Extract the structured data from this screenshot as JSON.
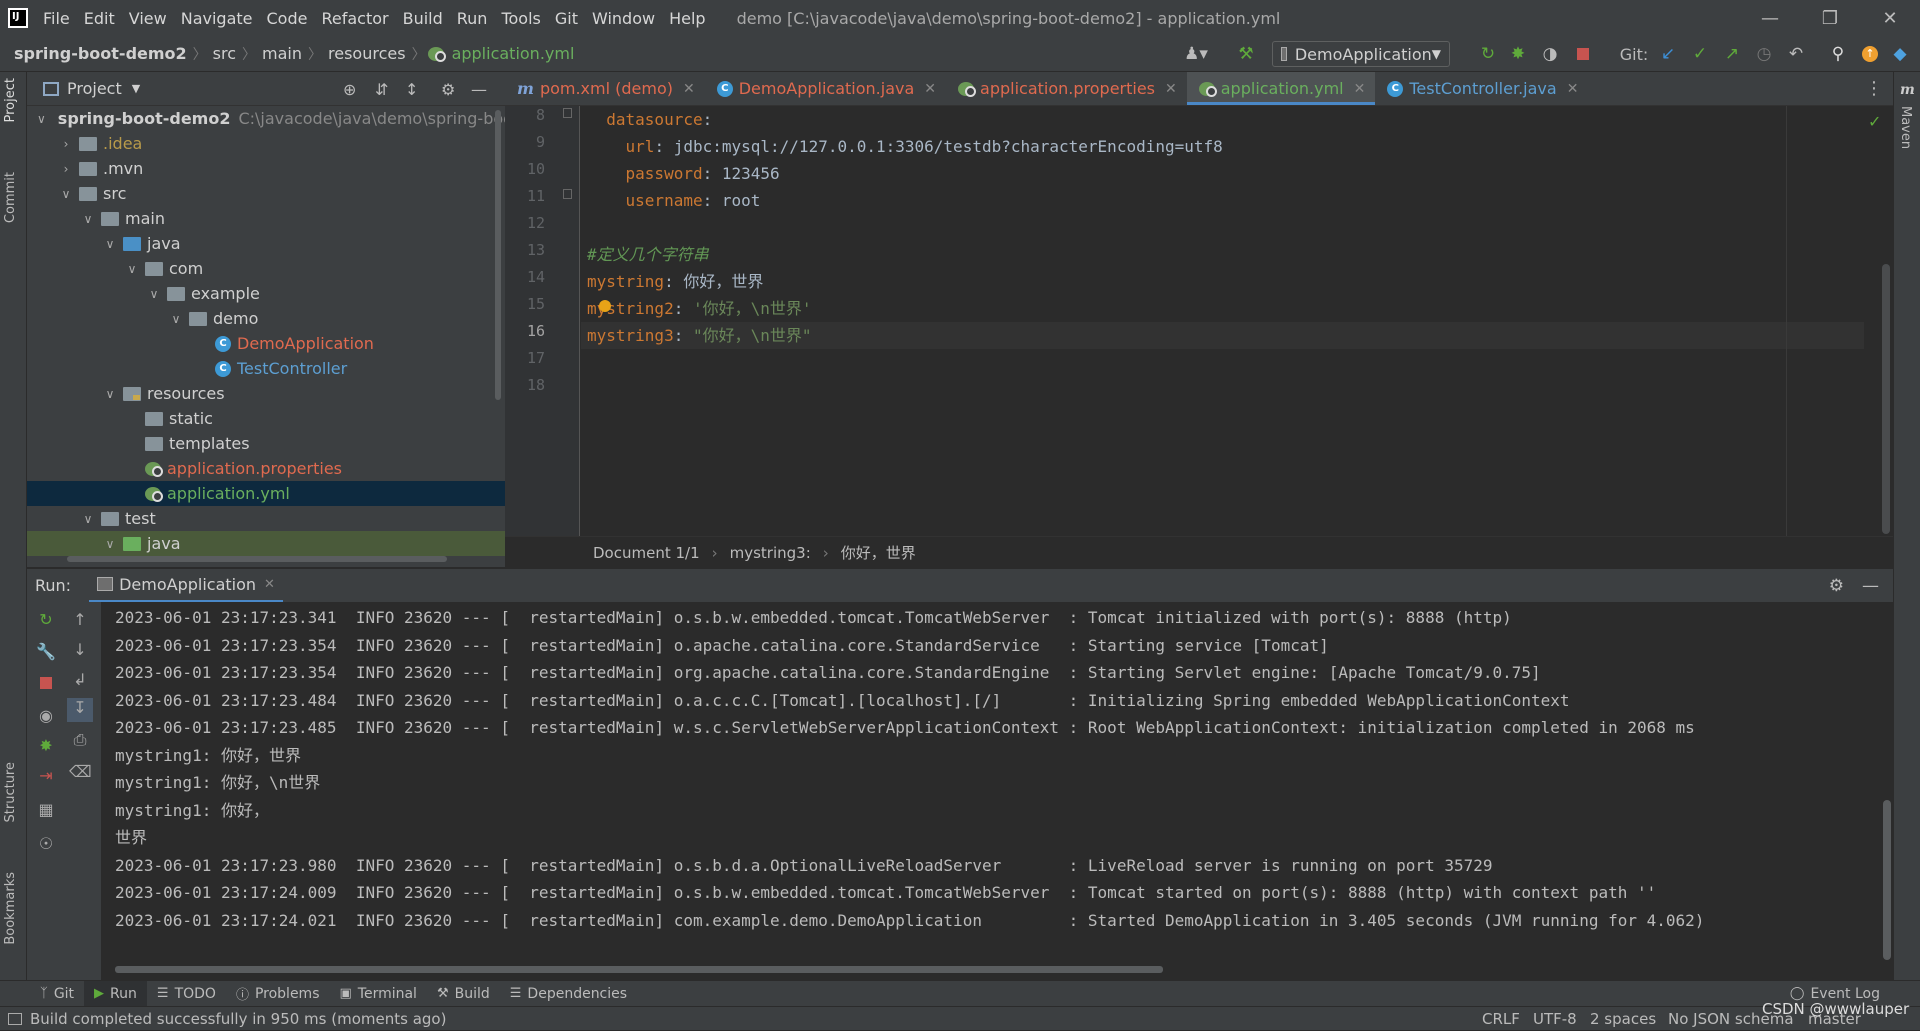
{
  "menubar": {
    "items": [
      "File",
      "Edit",
      "View",
      "Navigate",
      "Code",
      "Refactor",
      "Build",
      "Run",
      "Tools",
      "Git",
      "Window",
      "Help"
    ],
    "title": "demo [C:\\javacode\\java\\demo\\spring-boot-demo2] - application.yml"
  },
  "navbar": {
    "crumbs": [
      "spring-boot-demo2",
      "src",
      "main",
      "resources",
      "application.yml"
    ],
    "run_config": "DemoApplication",
    "git_label": "Git:"
  },
  "leftstrip": {
    "project": "Project",
    "commit": "Commit",
    "structure": "Structure",
    "bookmarks": "Bookmarks"
  },
  "rightstrip": {
    "maven": "Maven"
  },
  "project": {
    "title": "Project",
    "tree": [
      {
        "label": "spring-boot-demo2",
        "path": "C:\\javacode\\java\\demo\\spring-boot-"
      },
      {
        "label": ".idea"
      },
      {
        "label": ".mvn"
      },
      {
        "label": "src"
      },
      {
        "label": "main"
      },
      {
        "label": "java"
      },
      {
        "label": "com"
      },
      {
        "label": "example"
      },
      {
        "label": "demo"
      },
      {
        "label": "DemoApplication"
      },
      {
        "label": "TestController"
      },
      {
        "label": "resources"
      },
      {
        "label": "static"
      },
      {
        "label": "templates"
      },
      {
        "label": "application.properties"
      },
      {
        "label": "application.yml"
      },
      {
        "label": "test"
      },
      {
        "label": "java"
      }
    ]
  },
  "editor": {
    "tabs": [
      "pom.xml (demo)",
      "DemoApplication.java",
      "application.properties",
      "application.yml",
      "TestController.java"
    ],
    "active_tab": "application.yml",
    "line_numbers": [
      "8",
      "9",
      "10",
      "11",
      "12",
      "13",
      "14",
      "15",
      "16",
      "17",
      "18"
    ],
    "lines": [
      {
        "key": "  datasource",
        "punct": ":",
        "val": ""
      },
      {
        "key": "    url",
        "punct": ": ",
        "val": "jdbc:mysql://127.0.0.1:3306/testdb?characterEncoding=utf8"
      },
      {
        "key": "    password",
        "punct": ": ",
        "val": "123456"
      },
      {
        "key": "    username",
        "punct": ": ",
        "val": "root"
      },
      {
        "comment": ""
      },
      {
        "comment": "#定义几个字符串"
      },
      {
        "key": "mystring",
        "punct": ": ",
        "val": "你好，世界"
      },
      {
        "key": "mystring2",
        "punct": ": ",
        "str": "'你好，\\n世界'"
      },
      {
        "key": "mystring3",
        "punct": ": ",
        "str": "\"你好，\\n世界\""
      }
    ],
    "breadcrumbs": [
      "Document 1/1",
      "mystring3:",
      "你好，世界"
    ]
  },
  "run": {
    "label": "Run:",
    "tab": "DemoApplication",
    "console": [
      "2023-06-01 23:17:23.341  INFO 23620 --- [  restartedMain] o.s.b.w.embedded.tomcat.TomcatWebServer  : Tomcat initialized with port(s): 8888 (http)",
      "2023-06-01 23:17:23.354  INFO 23620 --- [  restartedMain] o.apache.catalina.core.StandardService   : Starting service [Tomcat]",
      "2023-06-01 23:17:23.354  INFO 23620 --- [  restartedMain] org.apache.catalina.core.StandardEngine  : Starting Servlet engine: [Apache Tomcat/9.0.75]",
      "2023-06-01 23:17:23.484  INFO 23620 --- [  restartedMain] o.a.c.c.C.[Tomcat].[localhost].[/]       : Initializing Spring embedded WebApplicationContext",
      "2023-06-01 23:17:23.485  INFO 23620 --- [  restartedMain] w.s.c.ServletWebServerApplicationContext : Root WebApplicationContext: initialization completed in 2068 ms",
      "mystring1: 你好，世界",
      "mystring1: 你好，\\n世界",
      "mystring1: 你好，",
      "世界",
      "2023-06-01 23:17:23.980  INFO 23620 --- [  restartedMain] o.s.b.d.a.OptionalLiveReloadServer       : LiveReload server is running on port 35729",
      "2023-06-01 23:17:24.009  INFO 23620 --- [  restartedMain] o.s.b.w.embedded.tomcat.TomcatWebServer  : Tomcat started on port(s): 8888 (http) with context path ''",
      "2023-06-01 23:17:24.021  INFO 23620 --- [  restartedMain] com.example.demo.DemoApplication         : Started DemoApplication in 3.405 seconds (JVM running for 4.062)"
    ]
  },
  "toolwindows": [
    "Git",
    "Run",
    "TODO",
    "Problems",
    "Terminal",
    "Build",
    "Dependencies"
  ],
  "event_log": "Event Log",
  "status": {
    "message": "Build completed successfully in 950 ms (moments ago)",
    "line_sep": "CRLF",
    "encoding": "UTF-8",
    "indent": "2 spaces",
    "schema": "No JSON schema",
    "branch": "master"
  },
  "watermark": "CSDN @wwwlauper",
  "colors": {
    "accent": "#4a88c7",
    "keyword": "#cc7832",
    "string": "#6a8759",
    "comment": "#629755"
  }
}
